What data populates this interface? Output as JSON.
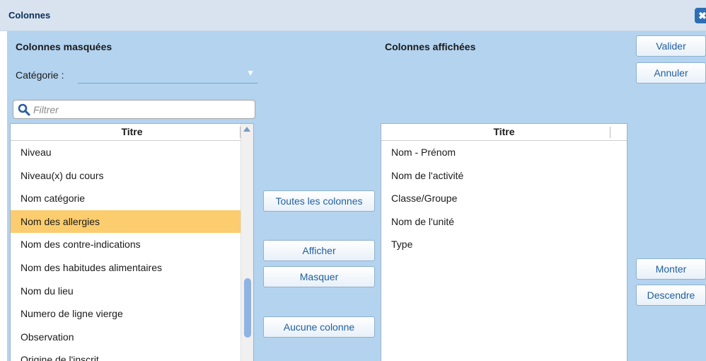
{
  "window": {
    "title": "Colonnes",
    "close_label": "✖"
  },
  "hidden_columns": {
    "heading": "Colonnes masquées",
    "category_label": "Catégorie :",
    "category_value": "",
    "filter_placeholder": "Filtrer",
    "filter_value": "",
    "header": "Titre",
    "items": [
      "Niveau",
      "Niveau(x) du cours",
      "Nom catégorie",
      "Nom des allergies",
      "Nom des contre-indications",
      "Nom des habitudes alimentaires",
      "Nom du lieu",
      "Numero de ligne vierge",
      "Observation",
      "Origine de l'inscrit"
    ],
    "selected_item": "Nom des allergies"
  },
  "shown_columns": {
    "heading": "Colonnes affichées",
    "header": "Titre",
    "items": [
      "Nom - Prénom",
      "Nom de l'activité",
      "Classe/Groupe",
      "Nom de l'unité",
      "Type"
    ]
  },
  "middle_buttons": {
    "all": "Toutes les colonnes",
    "show": "Afficher",
    "hide": "Masquer",
    "none": "Aucune colonne"
  },
  "right_buttons": {
    "validate": "Valider",
    "cancel": "Annuler",
    "up": "Monter",
    "down": "Descendre"
  },
  "colors": {
    "panel_bg": "#b3d3ef",
    "selected_bg": "#fbcd6e",
    "button_text": "#1f5f9f",
    "title_text": "#0c2d57"
  }
}
